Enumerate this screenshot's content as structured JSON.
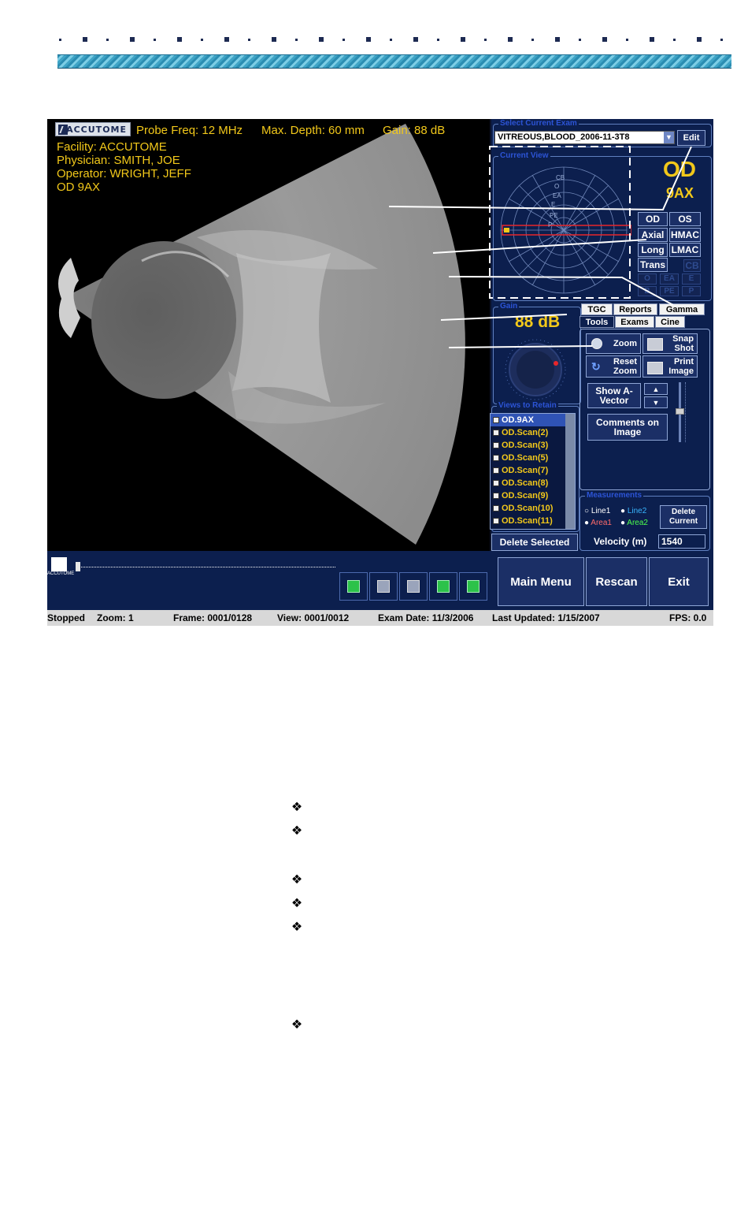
{
  "overlay": {
    "brand": "ACCUTOME",
    "probe_freq": "Probe Freq: 12 MHz",
    "max_depth": "Max. Depth: 60 mm",
    "gain": "Gain: 88 dB",
    "facility": "Facility: ACCUTOME",
    "physician": "Physician: SMITH, JOE",
    "operator": "Operator: WRIGHT, JEFF",
    "eye_view": "OD 9AX"
  },
  "exam_select": {
    "title": "Select Current Exam",
    "value": "VITREOUS,BLOOD_2006-11-3T8",
    "edit_label": "Edit"
  },
  "current_view": {
    "title": "Current View",
    "eye": "OD",
    "view": "9AX",
    "clock_labels": [
      "CB",
      "O",
      "EA",
      "E",
      "PE",
      "P"
    ],
    "buttons": [
      {
        "label": "OD",
        "enabled": true
      },
      {
        "label": "OS",
        "enabled": true
      },
      {
        "label": "Axial",
        "enabled": true
      },
      {
        "label": "HMAC",
        "enabled": true
      },
      {
        "label": "Long",
        "enabled": true
      },
      {
        "label": "LMAC",
        "enabled": true
      },
      {
        "label": "Trans",
        "enabled": true
      },
      {
        "label": "CB",
        "enabled": false
      },
      {
        "label": "O",
        "enabled": false
      },
      {
        "label": "EA",
        "enabled": false
      },
      {
        "label": "E",
        "enabled": false
      },
      {
        "label": "B",
        "enabled": false
      },
      {
        "label": "PE",
        "enabled": false
      },
      {
        "label": "P",
        "enabled": false
      }
    ]
  },
  "gain_panel": {
    "title": "Gain",
    "value": "88 dB"
  },
  "tabs": {
    "row1": [
      "TGC",
      "Reports",
      "Gamma"
    ],
    "row2": [
      "Tools",
      "Exams",
      "Cine"
    ],
    "active": "Tools"
  },
  "tools": {
    "zoom": "Zoom",
    "snap_shot": "Snap Shot",
    "reset_zoom": "Reset Zoom",
    "print_image": "Print Image",
    "show_avector": "Show A-Vector",
    "comments": "Comments on Image"
  },
  "views_to_retain": {
    "title": "Views to Retain",
    "items": [
      "OD.9AX",
      "OD.Scan(2)",
      "OD.Scan(3)",
      "OD.Scan(5)",
      "OD.Scan(7)",
      "OD.Scan(8)",
      "OD.Scan(9)",
      "OD.Scan(10)",
      "OD.Scan(11)"
    ],
    "delete_label": "Delete Selected"
  },
  "measurements": {
    "title": "Measurements",
    "line1": "Line1",
    "line2": "Line2",
    "area1": "Area1",
    "area2": "Area2",
    "delete_current": "Delete Current",
    "velocity_label": "Velocity (m)",
    "velocity_value": "1540",
    "colors": {
      "line1": "#ffffff",
      "line2": "#39b6ff",
      "area1": "#ff6a6a",
      "area2": "#4cff4c"
    }
  },
  "playback": {
    "buttons": [
      "play-icon",
      "stop-icon",
      "pause-icon",
      "step-back-icon",
      "step-forward-icon"
    ]
  },
  "nav": {
    "main_menu": "Main Menu",
    "rescan": "Rescan",
    "exit": "Exit"
  },
  "status": {
    "state": "Stopped",
    "zoom": "Zoom: 1",
    "frame": "Frame: 0001/0128",
    "view": "View: 0001/0012",
    "exam_date": "Exam Date: 11/3/2006",
    "last_updated": "Last Updated: 1/15/2007",
    "fps": "FPS: 0.0"
  },
  "colors": {
    "overlay_text": "#f2c81a",
    "panel_bg": "#0c1f4e",
    "panel_title": "#2c54d6"
  }
}
